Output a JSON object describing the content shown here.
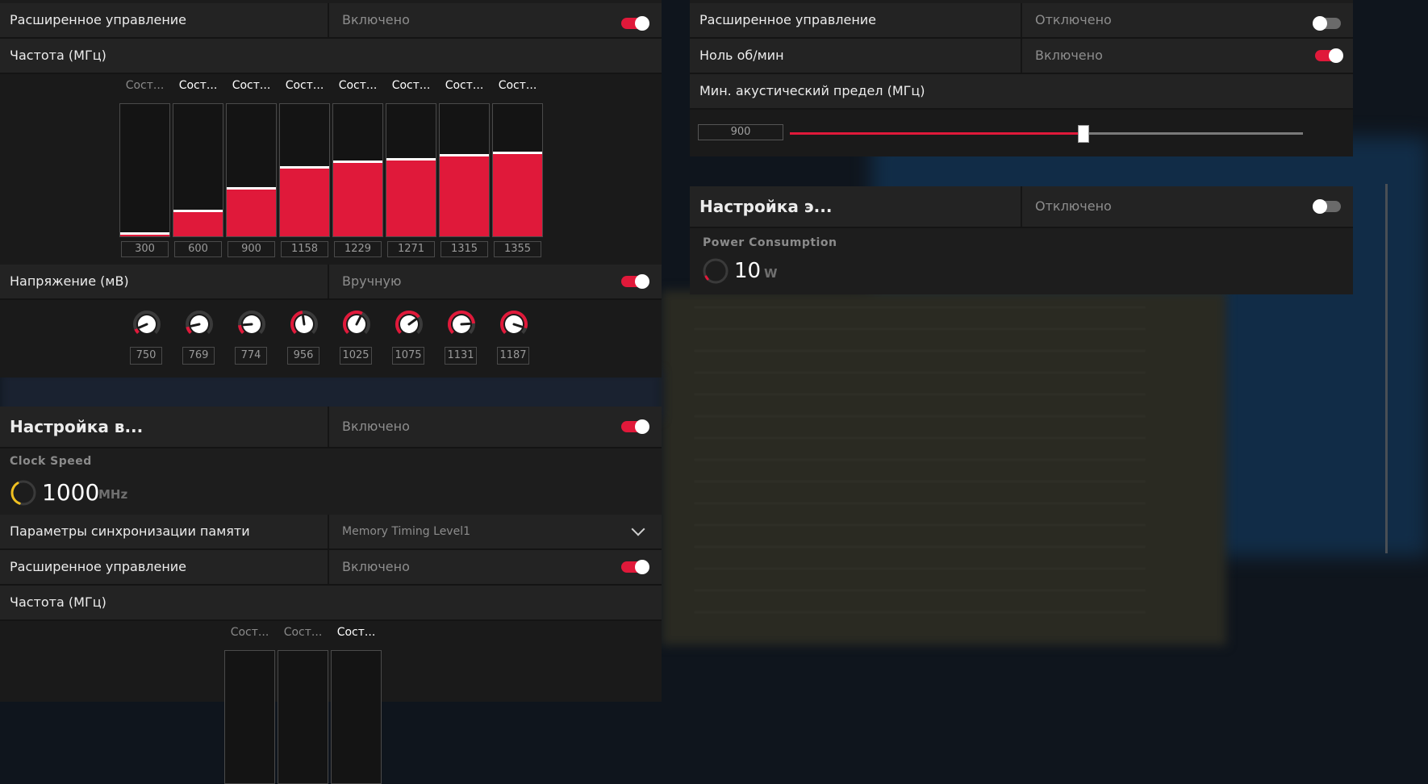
{
  "colors": {
    "accent": "#e0193a",
    "panel": "#232323",
    "text_dim": "#8d8d8d",
    "gauge_yellow": "#f0c020"
  },
  "left": {
    "row_adv1": {
      "label": "Расширенное управление",
      "value": "Включено",
      "toggle": "on"
    },
    "freq_header": {
      "label": "Частота (МГц)"
    },
    "freq_states": {
      "titles": [
        "Сост...",
        "Сост...",
        "Сост...",
        "Сост...",
        "Сост...",
        "Сост...",
        "Сост...",
        "Сост..."
      ],
      "values": [
        "300",
        "600",
        "900",
        "1158",
        "1229",
        "1271",
        "1315",
        "1355"
      ],
      "levels": [
        0.02,
        0.19,
        0.36,
        0.52,
        0.56,
        0.58,
        0.61,
        0.63
      ]
    },
    "voltage_row": {
      "label": "Напряжение (мВ)",
      "value": "Вручную",
      "toggle": "on"
    },
    "voltages": {
      "values": [
        "750",
        "769",
        "774",
        "956",
        "1025",
        "1075",
        "1131",
        "1187"
      ],
      "levels": [
        0.08,
        0.12,
        0.15,
        0.47,
        0.6,
        0.7,
        0.82,
        0.9
      ]
    },
    "vram_section": {
      "title": "Настройка в...",
      "value": "Включено",
      "toggle": "on"
    },
    "clock": {
      "title": "Clock Speed",
      "value": "1000",
      "unit": "MHz"
    },
    "mem_timing": {
      "label": "Параметры синхронизации памяти",
      "value": "Memory Timing Level1"
    },
    "row_adv2": {
      "label": "Расширенное управление",
      "value": "Включено",
      "toggle": "on"
    },
    "freq_header2": {
      "label": "Частота (МГц)"
    },
    "mem_states": {
      "titles": [
        "Сост...",
        "Сост...",
        "Сост..."
      ]
    }
  },
  "right": {
    "row_adv": {
      "label": "Расширенное управление",
      "value": "Отключено",
      "toggle": "off"
    },
    "zero_rpm": {
      "label": "Ноль об/мин",
      "value": "Включено",
      "toggle": "on"
    },
    "min_acoustic": {
      "label": "Мин. акустический предел (МГц)",
      "value": "900",
      "level": 0.57
    },
    "power_section": {
      "title": "Настройка э...",
      "value": "Отключено",
      "toggle": "off"
    },
    "power": {
      "title": "Power Consumption",
      "value": "10",
      "unit": "W"
    }
  }
}
